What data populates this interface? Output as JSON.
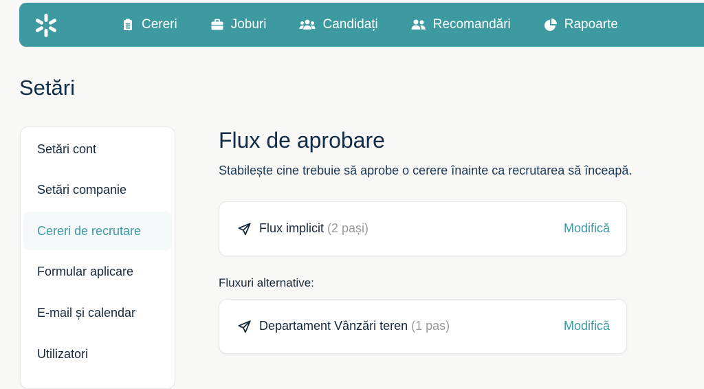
{
  "nav": {
    "items": [
      {
        "label": "Cereri",
        "icon": "clipboard-icon"
      },
      {
        "label": "Joburi",
        "icon": "briefcase-icon"
      },
      {
        "label": "Candidați",
        "icon": "users-icon"
      },
      {
        "label": "Recomandări",
        "icon": "user-pair-icon"
      },
      {
        "label": "Rapoarte",
        "icon": "pie-chart-icon"
      }
    ]
  },
  "page": {
    "title": "Setări"
  },
  "sidebar": {
    "items": [
      {
        "label": "Setări cont"
      },
      {
        "label": "Setări companie"
      },
      {
        "label": "Cereri de recrutare",
        "active": true
      },
      {
        "label": "Formular aplicare"
      },
      {
        "label": "E-mail și calendar"
      },
      {
        "label": "Utilizatori"
      }
    ]
  },
  "main": {
    "title": "Flux de aprobare",
    "description": "Stabilește cine trebuie să aprobe o cerere înainte ca recrutarea să înceapă.",
    "default_flow": {
      "name": "Flux implicit",
      "steps": "(2 pași)",
      "action": "Modifică"
    },
    "alternative_label": "Fluxuri alternative:",
    "alternative_flows": [
      {
        "name": "Departament Vânzări teren",
        "steps": "(1 pas)",
        "action": "Modifică"
      }
    ]
  },
  "colors": {
    "accent": "#3d9aa1",
    "text": "#0f2a44",
    "background": "#f8f8f7"
  }
}
